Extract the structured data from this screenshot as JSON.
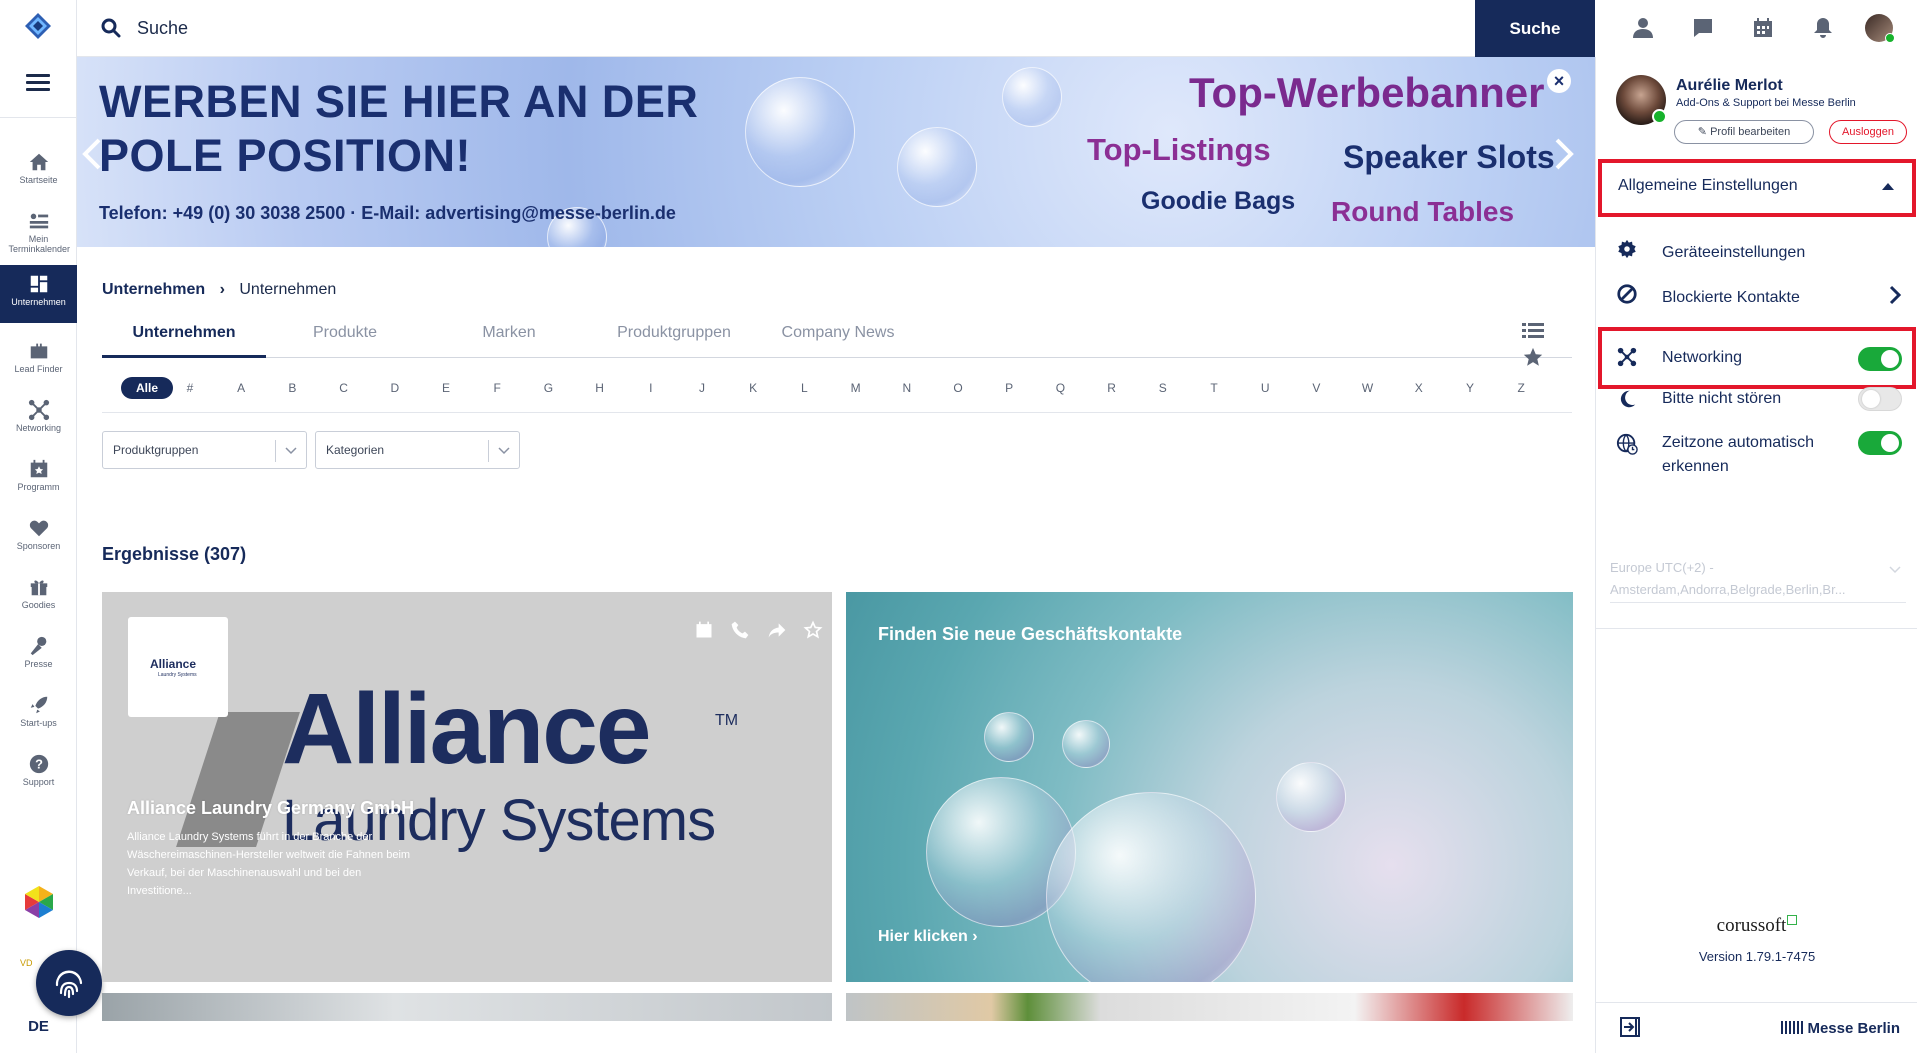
{
  "search": {
    "placeholder": "Suche",
    "button_label": "Suche"
  },
  "nav": {
    "items": [
      {
        "label": "Startseite",
        "icon": "home-icon"
      },
      {
        "label": "Mein Terminkalender",
        "icon": "calendar-list-icon"
      },
      {
        "label": "Unternehmen",
        "icon": "company-icon",
        "active": true
      },
      {
        "label": "Lead Finder",
        "icon": "briefcase-icon"
      },
      {
        "label": "Networking",
        "icon": "network-icon"
      },
      {
        "label": "Programm",
        "icon": "program-icon"
      },
      {
        "label": "Sponsoren",
        "icon": "handshake-icon"
      },
      {
        "label": "Goodies",
        "icon": "gift-icon"
      },
      {
        "label": "Presse",
        "icon": "microphone-icon"
      },
      {
        "label": "Start-ups",
        "icon": "rocket-icon"
      },
      {
        "label": "Support",
        "icon": "help-icon"
      }
    ],
    "language": "DE",
    "partner_text": "VD"
  },
  "banner": {
    "headline_line1": "WERBEN SIE HIER AN DER",
    "headline_line2": "POLE POSITION!",
    "contact": "Telefon: +49 (0) 30 3038 2500 · E-Mail: advertising@messe-berlin.de",
    "top": "Top-Werbebanner",
    "listings": "Top-Listings",
    "speaker": "Speaker Slots",
    "goodie": "Goodie Bags",
    "round": "Round Tables",
    "close": "×"
  },
  "breadcrumb": {
    "level1": "Unternehmen",
    "level2": "Unternehmen"
  },
  "tabs": [
    "Unternehmen",
    "Produkte",
    "Marken",
    "Produktgruppen",
    "Company News"
  ],
  "alphabet": [
    "Alle",
    "#",
    "A",
    "B",
    "C",
    "D",
    "E",
    "F",
    "G",
    "H",
    "I",
    "J",
    "K",
    "L",
    "M",
    "N",
    "O",
    "P",
    "Q",
    "R",
    "S",
    "T",
    "U",
    "V",
    "W",
    "X",
    "Y",
    "Z"
  ],
  "filters": {
    "product_groups": "Produktgruppen",
    "categories": "Kategorien"
  },
  "results_label": "Ergebnisse (307)",
  "card1": {
    "logo_small_name": "Alliance",
    "logo_small_sub": "Laundry Systems",
    "logo_big_name": "Alliance",
    "logo_big_sub": "Laundry Systems",
    "logo_tm": "TM",
    "title": "Alliance Laundry Germany GmbH",
    "description": "Alliance Laundry Systems führt in der Branche der Wäschereimaschinen-Hersteller weltweit die Fahnen beim Verkauf, bei der Maschinenauswahl und bei den Investitione..."
  },
  "card2": {
    "title": "Finden Sie neue Geschäftskontakte",
    "link": "Hier klicken"
  },
  "profile": {
    "name": "Aurélie Merlot",
    "role": "Add-Ons & Support bei Messe Berlin",
    "edit_label": "Profil bearbeiten",
    "logout_label": "Ausloggen"
  },
  "settings": {
    "header": "Allgemeine Einstellungen",
    "device": "Geräteeinstellungen",
    "blocked": "Blockierte Kontakte",
    "networking": "Networking",
    "networking_on": true,
    "dnd": "Bitte nicht stören",
    "dnd_on": false,
    "timezone_auto_line1": "Zeitzone automatisch",
    "timezone_auto_line2": "erkennen",
    "timezone_auto_on": true,
    "timezone_value_line1": "Europe UTC(+2) -",
    "timezone_value_line2": "Amsterdam,Andorra,Belgrade,Berlin,Br..."
  },
  "footer": {
    "brand": "corussoft",
    "version": "Version 1.79.1-7475",
    "organizer": "Messe Berlin"
  },
  "colors": {
    "primary": "#162a5a",
    "accent_red": "#e3172b",
    "toggle_on": "#19a93a"
  }
}
